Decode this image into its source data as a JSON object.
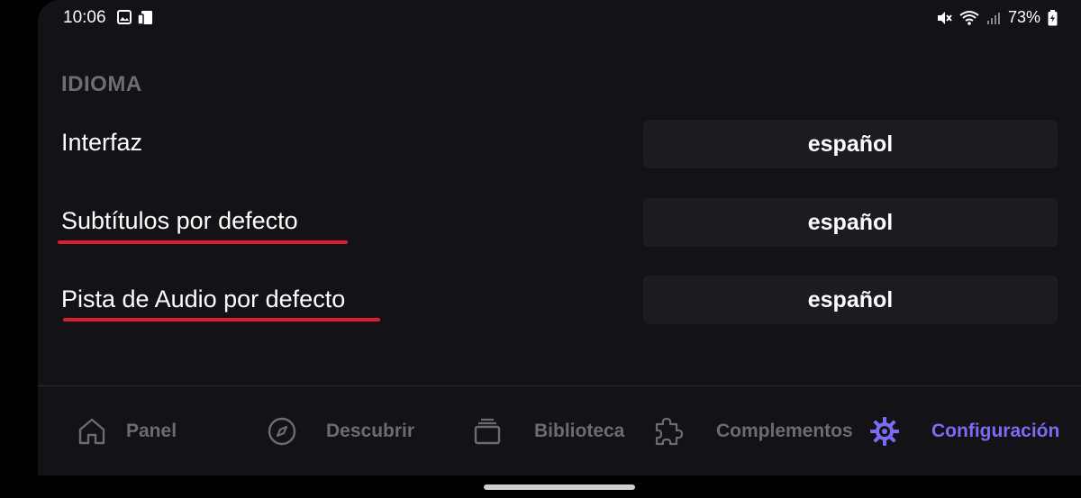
{
  "status_bar": {
    "time": "10:06",
    "battery": "73%",
    "icons_left": [
      "image-icon",
      "cast-icon"
    ],
    "icons_right": [
      "mute-icon",
      "wifi-icon",
      "signal-icon",
      "battery-icon"
    ]
  },
  "section": {
    "title": "IDIOMA",
    "rows": [
      {
        "label": "Interfaz",
        "value": "español",
        "highlighted": false
      },
      {
        "label": "Subtítulos por defecto",
        "value": "español",
        "highlighted": true
      },
      {
        "label": "Pista de Audio por defecto",
        "value": "español",
        "highlighted": true
      }
    ]
  },
  "nav": {
    "items": [
      {
        "label": "Panel",
        "icon": "home-icon",
        "active": false
      },
      {
        "label": "Descubrir",
        "icon": "compass-icon",
        "active": false
      },
      {
        "label": "Biblioteca",
        "icon": "library-icon",
        "active": false
      },
      {
        "label": "Complementos",
        "icon": "puzzle-icon",
        "active": false
      },
      {
        "label": "Configuración",
        "icon": "gear-icon",
        "active": true
      }
    ]
  },
  "colors": {
    "background": "#141217",
    "select_background": "#1d1b21",
    "accent": "#7b6cf6",
    "underline": "#d8202b",
    "muted_text": "#6d6b72"
  }
}
